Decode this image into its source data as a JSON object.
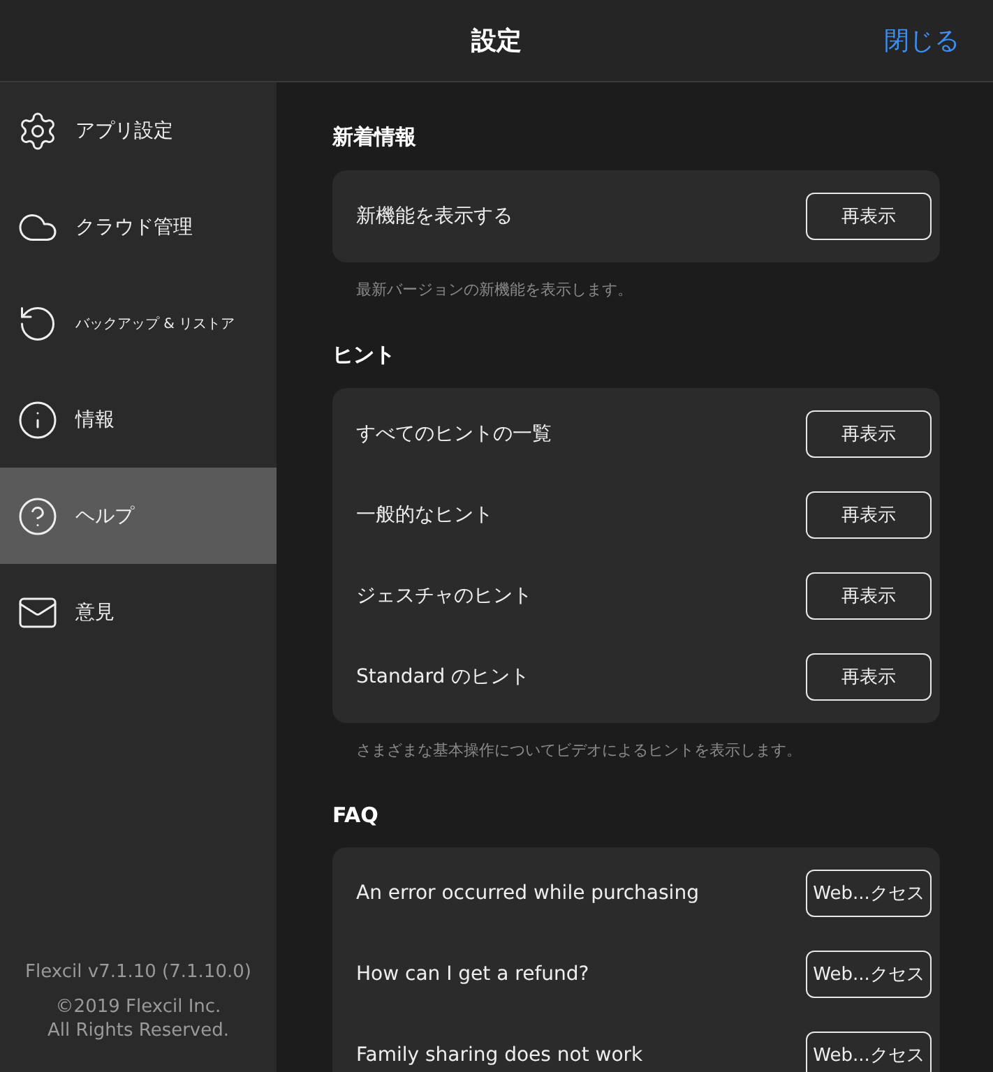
{
  "header": {
    "title": "設定",
    "close": "閉じる"
  },
  "sidebar": {
    "items": [
      {
        "kind": "gear",
        "label": "アプリ設定",
        "selected": false,
        "small": false
      },
      {
        "kind": "cloud",
        "label": "クラウド管理",
        "selected": false,
        "small": false
      },
      {
        "kind": "restore",
        "label": "バックアップ & リストア",
        "selected": false,
        "small": true
      },
      {
        "kind": "info",
        "label": "情報",
        "selected": false,
        "small": false
      },
      {
        "kind": "help",
        "label": "ヘルプ",
        "selected": true,
        "small": false
      },
      {
        "kind": "mail",
        "label": "意見",
        "selected": false,
        "small": false
      }
    ],
    "version": "Flexcil v7.1.10 (7.1.10.0)",
    "copyright": [
      "©2019 Flexcil Inc.",
      "All Rights Reserved."
    ]
  },
  "sections": [
    {
      "title": "新着情報",
      "rows": [
        {
          "label": "新機能を表示する",
          "button": "再表示"
        }
      ],
      "note": "最新バージョンの新機能を表示します。"
    },
    {
      "title": "ヒント",
      "rows": [
        {
          "label": "すべてのヒントの一覧",
          "button": "再表示"
        },
        {
          "label": "一般的なヒント",
          "button": "再表示"
        },
        {
          "label": "ジェスチャのヒント",
          "button": "再表示"
        },
        {
          "label": "Standard のヒント",
          "button": "再表示"
        }
      ],
      "note": "さまざまな基本操作についてビデオによるヒントを表示します。"
    },
    {
      "title": "FAQ",
      "rows": [
        {
          "label": "An error occurred while purchasing",
          "button": "Web...クセス"
        },
        {
          "label": "How can I get a refund?",
          "button": "Web...クセス"
        },
        {
          "label": "Family sharing does not work",
          "button": "Web...クセス"
        }
      ]
    }
  ]
}
